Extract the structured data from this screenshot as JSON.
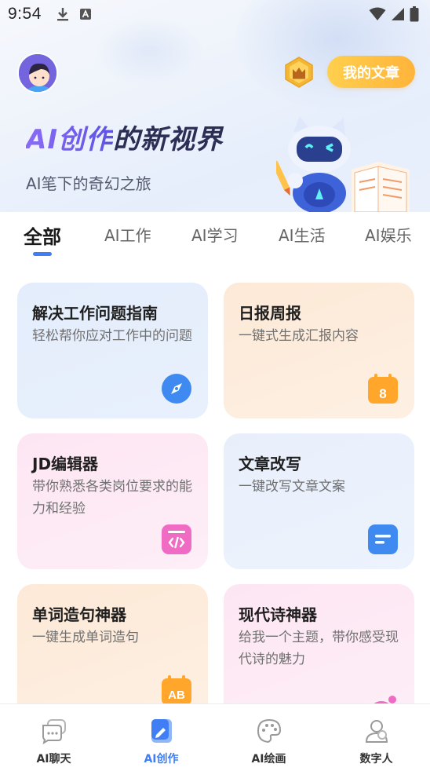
{
  "status_bar": {
    "time": "9:54"
  },
  "header": {
    "my_articles_label": "我的文章",
    "hero_title_ai": "AI创作",
    "hero_title_rest": "的新视界",
    "hero_subtitle": "AI笔下的奇幻之旅"
  },
  "tabs": [
    {
      "label": "全部",
      "active": true
    },
    {
      "label": "AI工作",
      "active": false
    },
    {
      "label": "AI学习",
      "active": false
    },
    {
      "label": "AI生活",
      "active": false
    },
    {
      "label": "AI娱乐",
      "active": false
    }
  ],
  "cards": [
    {
      "title": "解决工作问题指南",
      "desc": "轻松帮你应对工作中的问题",
      "icon": "compass-icon",
      "color": "#3f8af0"
    },
    {
      "title": "日报周报",
      "desc": "一键式生成汇报内容",
      "icon": "calendar-icon",
      "color": "#ffa62b"
    },
    {
      "title": "JD编辑器",
      "desc": "带你熟悉各类岗位要求的能力和经验",
      "icon": "code-icon",
      "color": "#f06cc4"
    },
    {
      "title": "文章改写",
      "desc": "一键改写文章文案",
      "icon": "document-icon",
      "color": "#3f8af0"
    },
    {
      "title": "单词造句神器",
      "desc": "一键生成单词造句",
      "icon": "ab-icon",
      "color": "#ffa62b"
    },
    {
      "title": "现代诗神器",
      "desc": "给我一个主题，带你感受现代诗的魅力",
      "icon": "poem-icon",
      "color": "#f06cc4"
    }
  ],
  "bottom_nav": [
    {
      "label": "AI聊天",
      "icon": "chat-icon",
      "active": false
    },
    {
      "label": "AI创作",
      "icon": "create-icon",
      "active": true
    },
    {
      "label": "AI绘画",
      "icon": "palette-icon",
      "active": false
    },
    {
      "label": "数字人",
      "icon": "person-icon",
      "active": false
    }
  ],
  "colors": {
    "accent": "#3f7ef5",
    "button_gradient_start": "#ffcf4d",
    "button_gradient_end": "#ffb43a"
  }
}
